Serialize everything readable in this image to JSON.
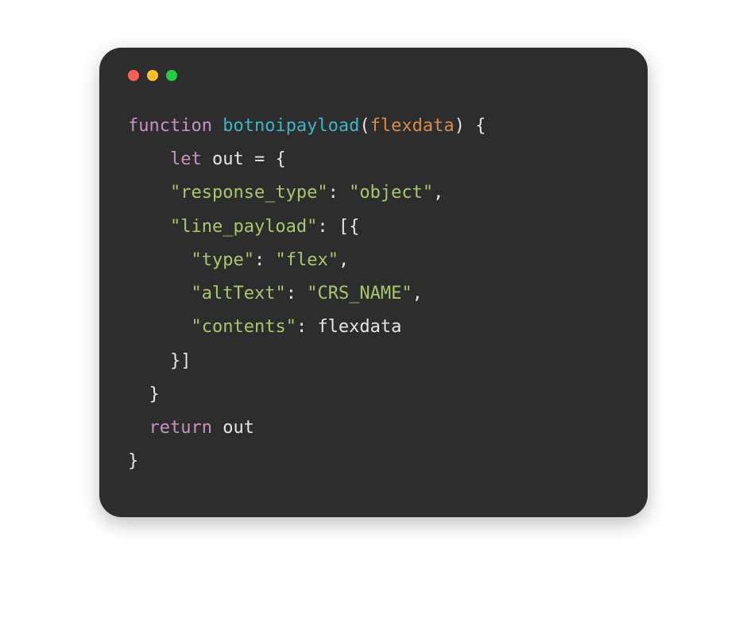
{
  "code": {
    "kw_function": "function",
    "space": " ",
    "fn_name": "botnoipayload",
    "paren_open": "(",
    "param_name": "flexdata",
    "paren_close_brace": ") {",
    "indent1": "    ",
    "kw_let": "let",
    "out_eq": " out = {",
    "key_response_type": "\"response_type\"",
    "colon_sp": ": ",
    "val_object": "\"object\"",
    "comma": ",",
    "key_line_payload": "\"line_payload\"",
    "arr_open": ": [{",
    "indent2": "      ",
    "key_type": "\"type\"",
    "val_flex": "\"flex\"",
    "key_altText": "\"altText\"",
    "val_crs": "\"CRS_NAME\"",
    "key_contents": "\"contents\"",
    "flexdata_ref": "flexdata",
    "arr_close_line": "    }]",
    "brace_close_inner": "  }",
    "indent_ret": "  ",
    "kw_return": "return",
    "out_ident": " out",
    "brace_close_outer": "}"
  }
}
